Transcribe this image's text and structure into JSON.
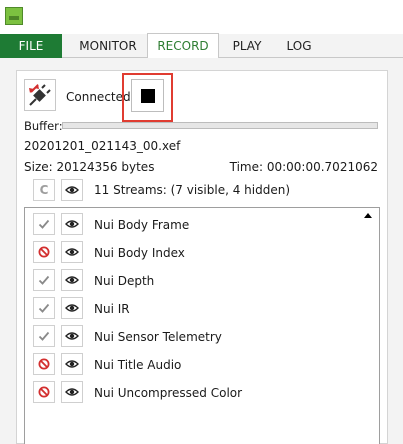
{
  "tabs": {
    "file": "FILE",
    "monitor": "MONITOR",
    "record": "RECORD",
    "play": "PLAY",
    "log": "LOG"
  },
  "connection": {
    "status": "Connected"
  },
  "buffer": {
    "label": "Buffer:"
  },
  "recording": {
    "filename": "20201201_021143_00.xef",
    "size": "Size: 20124356 bytes",
    "time": "Time: 00:00:00.7021062"
  },
  "streams": {
    "refresh_label": "C",
    "summary": "11 Streams: (7 visible, 4 hidden)",
    "items": [
      {
        "label": "Nui Body Frame",
        "state": "enabled"
      },
      {
        "label": "Nui Body Index",
        "state": "disabled"
      },
      {
        "label": "Nui Depth",
        "state": "enabled"
      },
      {
        "label": "Nui IR",
        "state": "enabled"
      },
      {
        "label": "Nui Sensor Telemetry",
        "state": "enabled"
      },
      {
        "label": "Nui Title Audio",
        "state": "disabled"
      },
      {
        "label": "Nui Uncompressed Color",
        "state": "disabled"
      }
    ]
  },
  "colors": {
    "file_tab": "#1e7b34",
    "active_tab_text": "#2e7d32",
    "highlight": "#e03c31",
    "disabled_icon": "#d32f2f",
    "check_icon": "#8a8a8a"
  },
  "icons": {
    "connect": "plug-connect-icon",
    "stop": "stop-icon",
    "eye": "eye-icon",
    "check": "checkmark-icon",
    "disabled": "no-entry-icon",
    "sort": "sort-arrow-icon"
  }
}
